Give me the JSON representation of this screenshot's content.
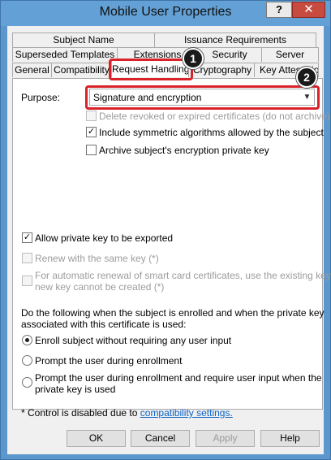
{
  "window": {
    "title": "Mobile User Properties",
    "help_label": "?",
    "close_label": "✕"
  },
  "tabs": {
    "row1": [
      "Subject Name",
      "Issuance Requirements"
    ],
    "row2": [
      "Superseded Templates",
      "Extensions",
      "Security",
      "Server"
    ],
    "row3": [
      "General",
      "Compatibility",
      "Request Handling",
      "Cryptography",
      "Key Attestation"
    ],
    "active": "Request Handling"
  },
  "purpose": {
    "label": "Purpose:",
    "selected": "Signature and encryption"
  },
  "options": {
    "delete_revoked": "Delete revoked or expired certificates (do not archive)",
    "include_symmetric": "Include symmetric algorithms allowed by the subject",
    "archive_key": "Archive subject's encryption private key",
    "allow_export": "Allow private key to be exported",
    "renew_same_key": "Renew with the same key (*)",
    "smart_card_line1": "For automatic renewal of smart card certificates, use the existing key if a",
    "smart_card_line2": "new key cannot be created (*)"
  },
  "enroll": {
    "intro_line1": "Do the following when the subject is enrolled and when the private key",
    "intro_line2": "associated with this certificate is used:",
    "radio1": "Enroll subject without requiring any user input",
    "radio2": "Prompt the user during enrollment",
    "radio3_line1": "Prompt the user during enrollment and require user input when the",
    "radio3_line2": "private key is used",
    "selected_index": 0
  },
  "footnote": {
    "text": "* Control is disabled due to ",
    "link": "compatibility settings."
  },
  "buttons": {
    "ok": "OK",
    "cancel": "Cancel",
    "apply": "Apply",
    "help": "Help"
  },
  "callouts": [
    "1",
    "2"
  ],
  "colors": {
    "highlight": "#d9222a",
    "titlebar": "#62a0d5",
    "link": "#0b62c4"
  }
}
